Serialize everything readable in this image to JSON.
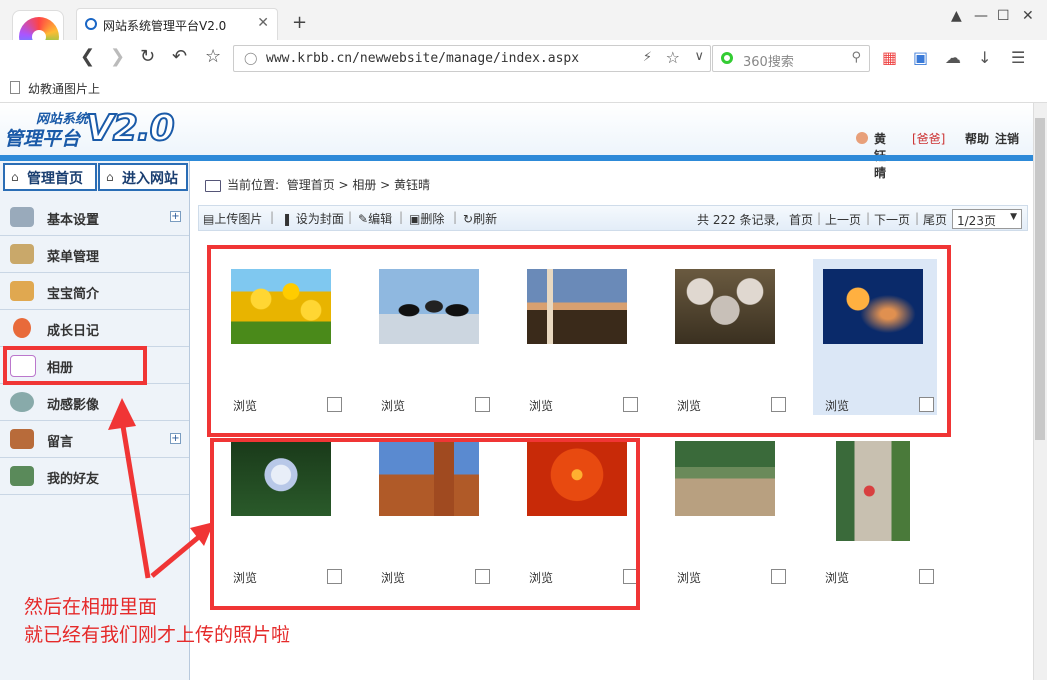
{
  "browser": {
    "tab_title": "网站系统管理平台V2.0",
    "tab_close": "✕",
    "new_tab": "+",
    "url": "www.krbb.cn/newwebsite/manage/index.aspx",
    "search_placeholder": "360搜索",
    "bookmark": "幼教通图片上",
    "icons": [
      "back-icon",
      "forward-icon",
      "reload-icon",
      "undo-icon",
      "star-icon",
      "grid-icon",
      "screenshot-icon",
      "cloud-icon",
      "download-icon",
      "menu-icon"
    ]
  },
  "header": {
    "logo_sub": "网站系统",
    "logo_main": "管理平台",
    "logo_version": "V2.0",
    "user_name": "黄钰晴",
    "user_role": "[爸爸]",
    "help": "帮助",
    "logout": "注销"
  },
  "sidebar": {
    "top_buttons": [
      {
        "label": "管理首页"
      },
      {
        "label": "进入网站"
      }
    ],
    "items": [
      {
        "label": "基本设置",
        "expandable": true
      },
      {
        "label": "菜单管理",
        "expandable": false
      },
      {
        "label": "宝宝简介",
        "expandable": false
      },
      {
        "label": "成长日记",
        "expandable": false
      },
      {
        "label": "相册",
        "expandable": false
      },
      {
        "label": "动感影像",
        "expandable": false
      },
      {
        "label": "留言",
        "expandable": true
      },
      {
        "label": "我的好友",
        "expandable": false
      }
    ],
    "plus": "+"
  },
  "breadcrumb": {
    "prefix": "当前位置:",
    "path": "管理首页 > 相册 > 黄钰晴"
  },
  "actions": {
    "upload": "上传图片",
    "set_cover": "设为封面",
    "edit": "编辑",
    "delete": "删除",
    "refresh": "刷新"
  },
  "pagination": {
    "summary": "共 222 条记录,",
    "first": "首页",
    "prev": "上一页",
    "next": "下一页",
    "last": "尾页",
    "current_page": "1/23页"
  },
  "photos": [
    {
      "label": "浏览",
      "subject": "yellow tulips"
    },
    {
      "label": "浏览",
      "subject": "penguins"
    },
    {
      "label": "浏览",
      "subject": "lighthouse"
    },
    {
      "label": "浏览",
      "subject": "koala"
    },
    {
      "label": "浏览",
      "subject": "jellyfish",
      "selected": true
    },
    {
      "label": "浏览",
      "subject": "hydrangea"
    },
    {
      "label": "浏览",
      "subject": "desert"
    },
    {
      "label": "浏览",
      "subject": "chrysanthemum"
    },
    {
      "label": "浏览",
      "subject": "children outdoors"
    },
    {
      "label": "浏览",
      "subject": "child walking"
    }
  ],
  "annotation": {
    "line1": "然后在相册里面",
    "line2": "就已经有我们刚才上传的照片啦",
    "color": "#f03535"
  }
}
